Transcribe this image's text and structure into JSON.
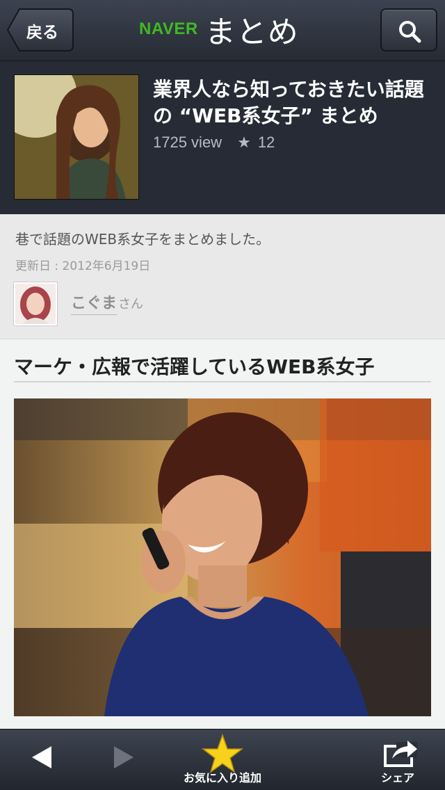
{
  "navbar": {
    "back_label": "戻る",
    "brand_naver": "NAVER",
    "brand_matome": "まとめ",
    "search_icon": "search-icon"
  },
  "hero": {
    "title": "業界人なら知っておきたい話題の “WEB系女子” まとめ",
    "views": "1725 view",
    "favorites": "12"
  },
  "summary": {
    "description": "巷で話題のWEB系女子をまとめました。",
    "updated": "更新日 : 2012年6月19日",
    "author_name": "こぐま",
    "author_suffix": "さん"
  },
  "section": {
    "heading": "マーケ・広報で活躍しているWEB系女子"
  },
  "toolbar": {
    "back_icon": "triangle-left-icon",
    "forward_icon": "triangle-right-icon",
    "favorite_label": "お気に入り追加",
    "share_label": "シェア"
  },
  "colors": {
    "navbar": "#2f3540",
    "brand_green": "#3fba22",
    "star_yellow": "#f6d21d"
  }
}
